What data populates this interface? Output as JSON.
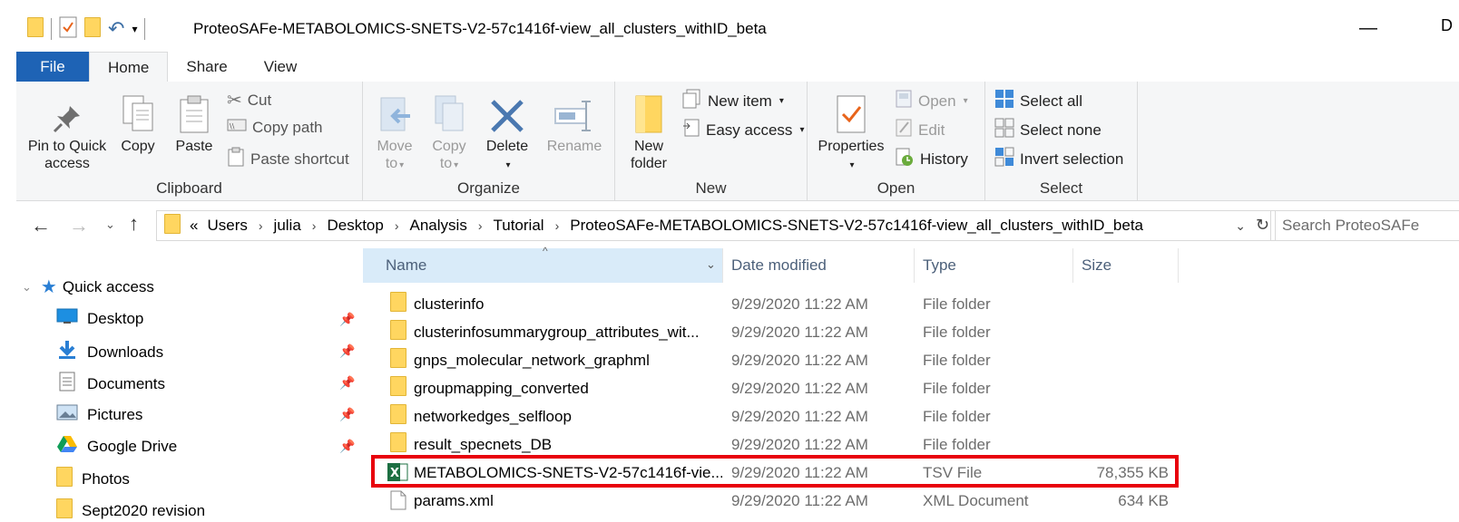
{
  "window": {
    "title": "ProteoSAFe-METABOLOMICS-SNETS-V2-57c1416f-view_all_clusters_withID_beta",
    "minimize_glyph": "—",
    "maximize_glyph": "D"
  },
  "ribbon_tabs": [
    "File",
    "Home",
    "Share",
    "View"
  ],
  "ribbon": {
    "clipboard": {
      "label": "Clipboard",
      "pin": "Pin to Quick access",
      "copy": "Copy",
      "paste": "Paste",
      "cut": "Cut",
      "copy_path": "Copy path",
      "paste_shortcut": "Paste shortcut"
    },
    "organize": {
      "label": "Organize",
      "move_to": "Move to",
      "copy_to": "Copy to",
      "delete": "Delete",
      "rename": "Rename"
    },
    "new": {
      "label": "New",
      "new_folder": "New folder",
      "new_item": "New item",
      "easy_access": "Easy access"
    },
    "open": {
      "label": "Open",
      "properties": "Properties",
      "open": "Open",
      "edit": "Edit",
      "history": "History"
    },
    "select": {
      "label": "Select",
      "select_all": "Select all",
      "select_none": "Select none",
      "invert_selection": "Invert selection"
    }
  },
  "address": {
    "overflow": "«",
    "crumbs": [
      "Users",
      "julia",
      "Desktop",
      "Analysis",
      "Tutorial",
      "ProteoSAFe-METABOLOMICS-SNETS-V2-57c1416f-view_all_clusters_withID_beta"
    ],
    "search_placeholder": "Search ProteoSAFe"
  },
  "nav": {
    "quick_access": "Quick access",
    "items": [
      {
        "label": "Desktop",
        "icon": "desktop-icon",
        "pinned": true
      },
      {
        "label": "Downloads",
        "icon": "downloads-icon",
        "pinned": true
      },
      {
        "label": "Documents",
        "icon": "documents-icon",
        "pinned": true
      },
      {
        "label": "Pictures",
        "icon": "pictures-icon",
        "pinned": true
      },
      {
        "label": "Google Drive",
        "icon": "google-drive-icon",
        "pinned": true
      },
      {
        "label": "Photos",
        "icon": "folder-icon",
        "pinned": false
      },
      {
        "label": "Sept2020 revision",
        "icon": "folder-icon",
        "pinned": false
      }
    ]
  },
  "columns": {
    "name": "Name",
    "date": "Date modified",
    "type": "Type",
    "size": "Size"
  },
  "files": [
    {
      "name": "clusterinfo",
      "date": "9/29/2020 11:22 AM",
      "type": "File folder",
      "size": "",
      "icon": "folder-icon"
    },
    {
      "name": "clusterinfosummarygroup_attributes_wit...",
      "date": "9/29/2020 11:22 AM",
      "type": "File folder",
      "size": "",
      "icon": "folder-icon"
    },
    {
      "name": "gnps_molecular_network_graphml",
      "date": "9/29/2020 11:22 AM",
      "type": "File folder",
      "size": "",
      "icon": "folder-icon"
    },
    {
      "name": "groupmapping_converted",
      "date": "9/29/2020 11:22 AM",
      "type": "File folder",
      "size": "",
      "icon": "folder-icon"
    },
    {
      "name": "networkedges_selfloop",
      "date": "9/29/2020 11:22 AM",
      "type": "File folder",
      "size": "",
      "icon": "folder-icon"
    },
    {
      "name": "result_specnets_DB",
      "date": "9/29/2020 11:22 AM",
      "type": "File folder",
      "size": "",
      "icon": "folder-icon"
    },
    {
      "name": "METABOLOMICS-SNETS-V2-57c1416f-vie...",
      "date": "9/29/2020 11:22 AM",
      "type": "TSV File",
      "size": "78,355 KB",
      "icon": "excel-icon"
    },
    {
      "name": "params.xml",
      "date": "9/29/2020 11:22 AM",
      "type": "XML Document",
      "size": "634 KB",
      "icon": "xml-file-icon"
    }
  ],
  "colors": {
    "file_tab": "#1e63b5",
    "highlight_border": "#e8000b",
    "column_header_text": "#4c607a",
    "name_header_bg": "#d9ebf9"
  }
}
